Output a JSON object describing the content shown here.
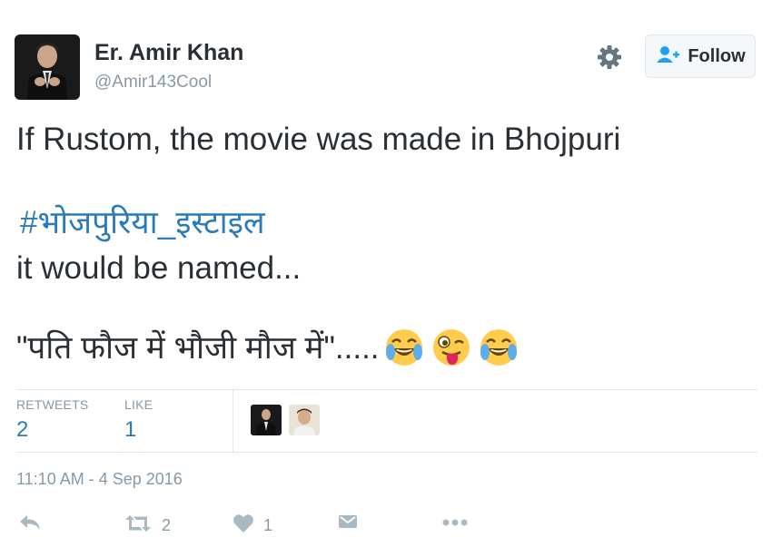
{
  "user": {
    "display_name": "Er. Amir Khan",
    "handle": "@Amir143Cool"
  },
  "header": {
    "follow_label": "Follow"
  },
  "tweet": {
    "line1": "If Rustom, the movie was made in Bhojpuri",
    "hashtag": "#भोजपुरिया_इस्टाइल",
    "line3": "it would be named...",
    "line4": "\"पति फौज में भौजी मौज में\".....",
    "emojis": [
      "face-with-tears-of-joy",
      "winking-face-with-tongue",
      "face-with-tears-of-joy"
    ]
  },
  "stats": {
    "retweets_label": "RETWEETS",
    "retweets_value": "2",
    "likes_label": "LIKE",
    "likes_value": "1"
  },
  "timestamp": "11:10 AM - 4 Sep 2016",
  "actions": {
    "retweet_count": "2",
    "like_count": "1"
  },
  "colors": {
    "link_blue": "#2b7bb9",
    "text": "#292f33",
    "muted": "#8899a6",
    "border": "#e1e8ed",
    "icon_gray": "#aab8c2"
  }
}
